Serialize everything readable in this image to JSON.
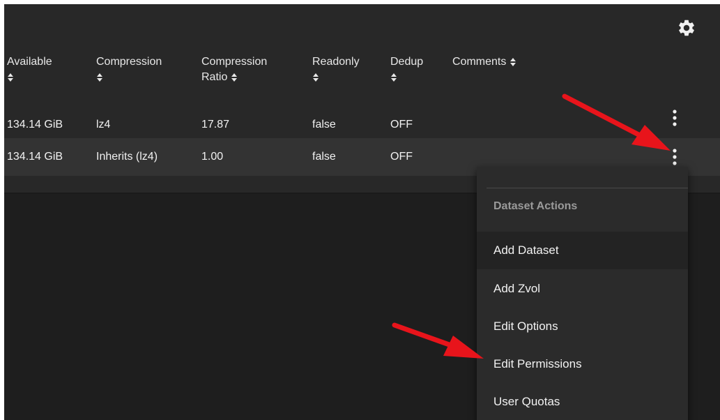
{
  "table": {
    "columns": [
      {
        "line1": "Available",
        "line2": ""
      },
      {
        "line1": "Compression",
        "line2": ""
      },
      {
        "line1": "Compression",
        "line2": "Ratio"
      },
      {
        "line1": "Readonly",
        "line2": ""
      },
      {
        "line1": "Dedup",
        "line2": ""
      },
      {
        "line1": "Comments",
        "line2": ""
      }
    ],
    "rows": [
      {
        "available": "134.14 GiB",
        "compression": "lz4",
        "ratio": "17.87",
        "readonly": "false",
        "dedup": "OFF",
        "comments": ""
      },
      {
        "available": "134.14 GiB",
        "compression": "Inherits (lz4)",
        "ratio": "1.00",
        "readonly": "false",
        "dedup": "OFF",
        "comments": ""
      }
    ]
  },
  "menu": {
    "header": "Dataset Actions",
    "items": [
      "Add Dataset",
      "Add Zvol",
      "Edit Options",
      "Edit Permissions",
      "User Quotas"
    ]
  },
  "icons": {
    "settings": "gear-icon",
    "sort": "sort-icon",
    "row_actions": "more-vert-icon",
    "annotation": "red-arrow"
  },
  "colors": {
    "background": "#1e1e1e",
    "panel": "#282828",
    "row_alt": "#333333",
    "menu": "#2b2b2b",
    "text": "#f2f2f2",
    "muted": "#9a9a9a",
    "arrow": "#e8141b"
  }
}
